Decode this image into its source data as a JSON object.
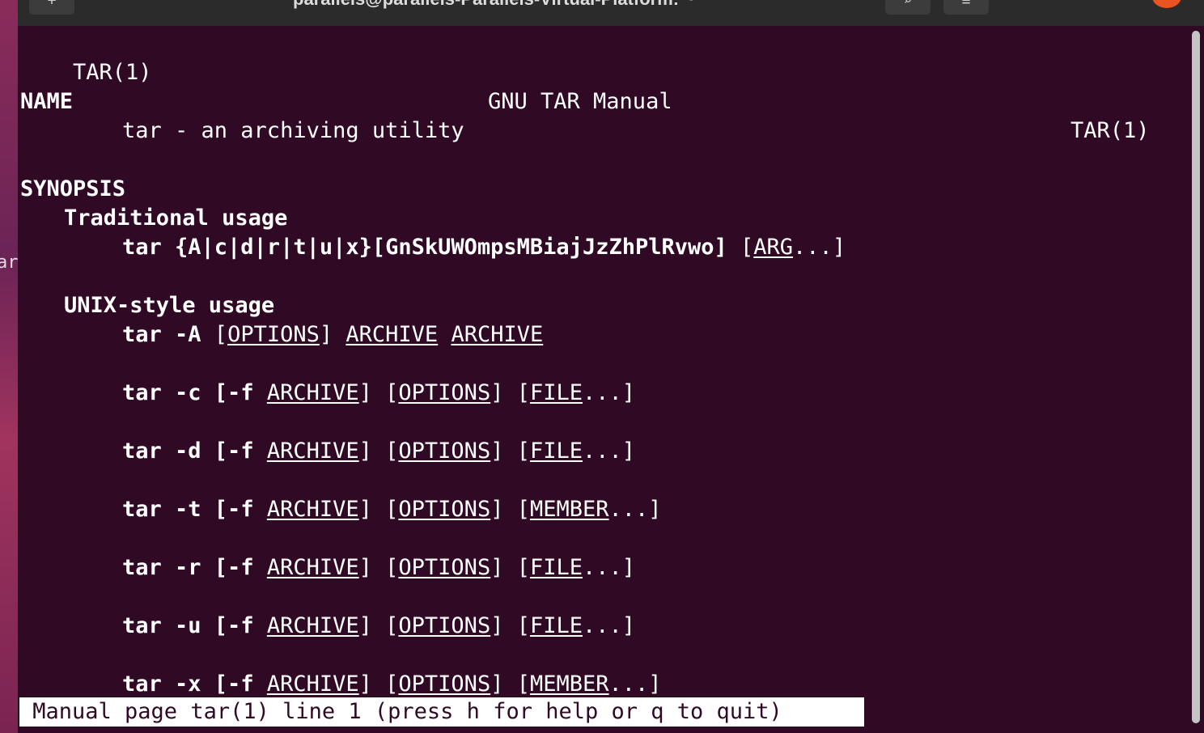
{
  "window": {
    "title": "parallels@parallels-Parallels-Virtual-Platform: ~",
    "new_tab_icon": "+",
    "search_icon": "⌕",
    "menu_icon": "≡"
  },
  "desktop": {
    "fragment": "ar"
  },
  "man": {
    "header": {
      "left": "TAR(1)",
      "center": "GNU TAR Manual",
      "right": "TAR(1)"
    },
    "name_heading": "NAME",
    "name_line": "tar - an archiving utility",
    "synopsis_heading": "SYNOPSIS",
    "traditional_heading": "Traditional usage",
    "traditional": {
      "cmd": "tar {A|c|d|r|t|u|x}[GnSkUWOmpsMBiajJzZhPlRvwo]",
      "open": " [",
      "arg": "ARG",
      "close": "...]"
    },
    "unix_heading": "UNIX-style usage",
    "unix_A": {
      "cmd": "tar -A",
      "sp1": " [",
      "opt": "OPTIONS",
      "close1": "] ",
      "arch1": "ARCHIVE",
      "sp2": " ",
      "arch2": "ARCHIVE"
    },
    "unix_rows": [
      {
        "cmd": "tar -c",
        "f": " [-f ",
        "archive": "ARCHIVE",
        "mid1": "] [",
        "options": "OPTIONS",
        "mid2": "] [",
        "item": "FILE",
        "end": "...]"
      },
      {
        "cmd": "tar -d",
        "f": " [-f ",
        "archive": "ARCHIVE",
        "mid1": "] [",
        "options": "OPTIONS",
        "mid2": "] [",
        "item": "FILE",
        "end": "...]"
      },
      {
        "cmd": "tar -t",
        "f": " [-f ",
        "archive": "ARCHIVE",
        "mid1": "] [",
        "options": "OPTIONS",
        "mid2": "] [",
        "item": "MEMBER",
        "end": "...]"
      },
      {
        "cmd": "tar -r",
        "f": " [-f ",
        "archive": "ARCHIVE",
        "mid1": "] [",
        "options": "OPTIONS",
        "mid2": "] [",
        "item": "FILE",
        "end": "...]"
      },
      {
        "cmd": "tar -u",
        "f": " [-f ",
        "archive": "ARCHIVE",
        "mid1": "] [",
        "options": "OPTIONS",
        "mid2": "] [",
        "item": "FILE",
        "end": "...]"
      },
      {
        "cmd": "tar -x",
        "f": " [-f ",
        "archive": "ARCHIVE",
        "mid1": "] [",
        "options": "OPTIONS",
        "mid2": "] [",
        "item": "MEMBER",
        "end": "...]"
      }
    ],
    "status": " Manual page tar(1) line 1 (press h for help or q to quit)"
  },
  "colors": {
    "terminal_bg": "#300a24",
    "text": "#ffffff",
    "accent": "#e95420"
  }
}
